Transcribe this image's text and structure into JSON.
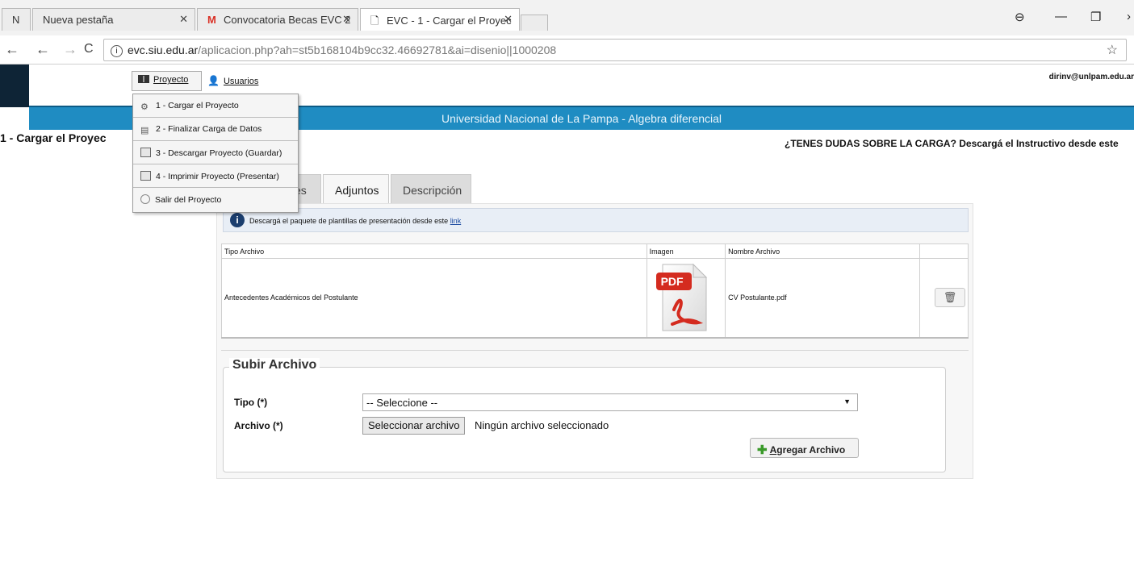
{
  "browser": {
    "tabs": [
      {
        "label": "N"
      },
      {
        "label": "Nueva pestaña"
      },
      {
        "label": "Convocatoria Becas EVC 2"
      },
      {
        "label": "EVC - 1 - Cargar el Proyec"
      }
    ],
    "url_host": "evc.siu.edu.ar",
    "url_path": "/aplicacion.php?ah=st5b168104b9cc32.46692781&ai=disenio||1000208"
  },
  "nav": {
    "proyecto": "Proyecto",
    "usuarios": "Usuarios",
    "user_email": "dirinv@unlpam.edu.ar"
  },
  "menu": {
    "items": [
      {
        "label": "1 - Cargar el Proyecto"
      },
      {
        "label": "2 - Finalizar Carga de Datos"
      },
      {
        "label": "3 - Descargar Proyecto (Guardar)"
      },
      {
        "label": "4 - Imprimir Proyecto (Presentar)"
      },
      {
        "label": "Salir del Proyecto"
      }
    ]
  },
  "banner": "Universidad Nacional de La Pampa - Algebra diferencial",
  "page_title": "1 - Cargar el Proyec",
  "doubts_text": "¿TENES DUDAS SOBRE LA CARGA? Descargá el Instructivo desde este",
  "tabs": {
    "partial": "es",
    "adjuntos": "Adjuntos",
    "descripcion": "Descripción"
  },
  "info": {
    "text": "Descargá el paquete de plantillas de presentación desde este",
    "link": "link"
  },
  "table": {
    "headers": [
      "Tipo Archivo",
      "Imagen",
      "Nombre Archivo",
      ""
    ],
    "rows": [
      {
        "tipo": "Antecedentes Académicos del Postulante",
        "imagen_label": "PDF",
        "nombre": "CV Postulante.pdf"
      }
    ]
  },
  "upload": {
    "legend": "Subir Archivo",
    "tipo_label": "Tipo (*)",
    "tipo_value": "-- Seleccione --",
    "archivo_label": "Archivo (*)",
    "file_button": "Seleccionar archivo",
    "file_status": "Ningún archivo seleccionado",
    "add_button_accel": "A",
    "add_button_rest": "gregar Archivo"
  },
  "colors": {
    "banner": "#1f8cc2",
    "left_dark": "#0e2436",
    "pdf_red": "#d42b1f"
  }
}
